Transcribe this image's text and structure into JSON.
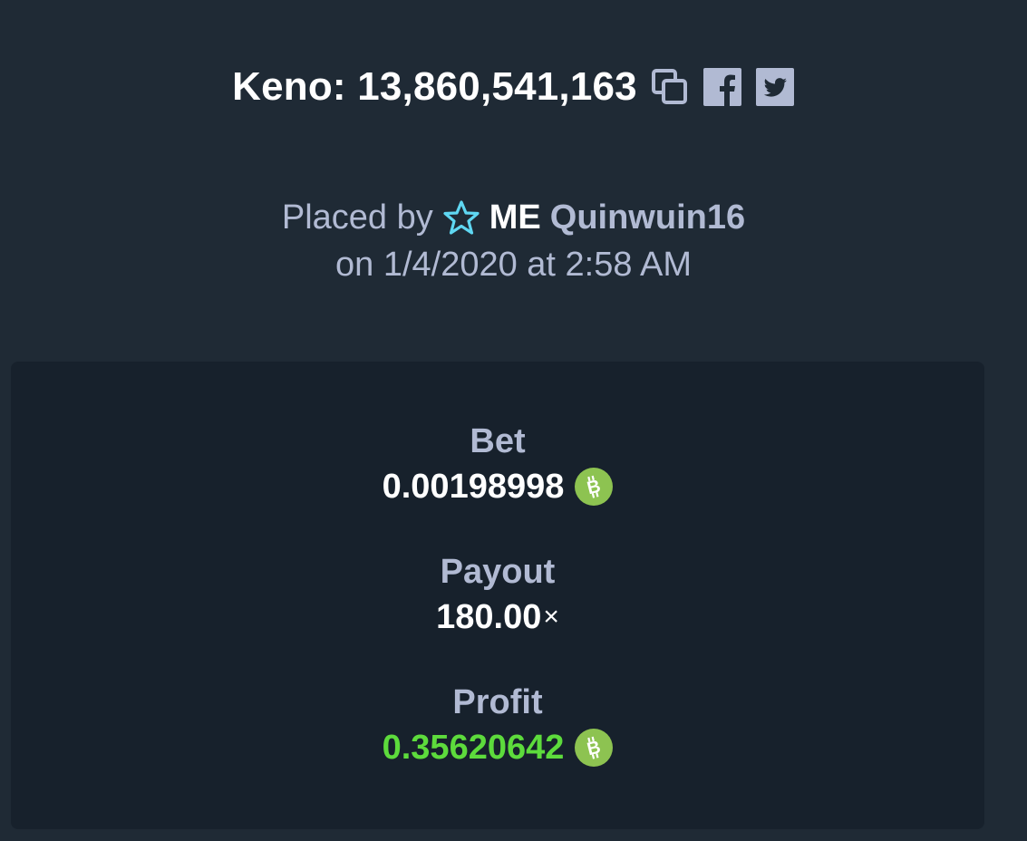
{
  "header": {
    "title": "Keno: 13,860,541,163",
    "icons": [
      "copy-icon",
      "facebook-icon",
      "twitter-icon"
    ]
  },
  "placed": {
    "prefix": "Placed by",
    "badge": "ME",
    "username": "Quinwuin16",
    "datetime": "on 1/4/2020 at 2:58 AM"
  },
  "stats": {
    "bet_label": "Bet",
    "bet_value": "0.00198998",
    "payout_label": "Payout",
    "payout_value": "180.00",
    "payout_suffix": "×",
    "profit_label": "Profit",
    "profit_value": "0.35620642",
    "currency_icon": "bitcoin-cash-icon"
  },
  "colors": {
    "background": "#1f2a35",
    "panel": "#17212c",
    "muted_text": "#b1bad3",
    "profit_green": "#5ddb3c",
    "coin_green": "#8dc351",
    "star_blue": "#5fd7f2"
  }
}
